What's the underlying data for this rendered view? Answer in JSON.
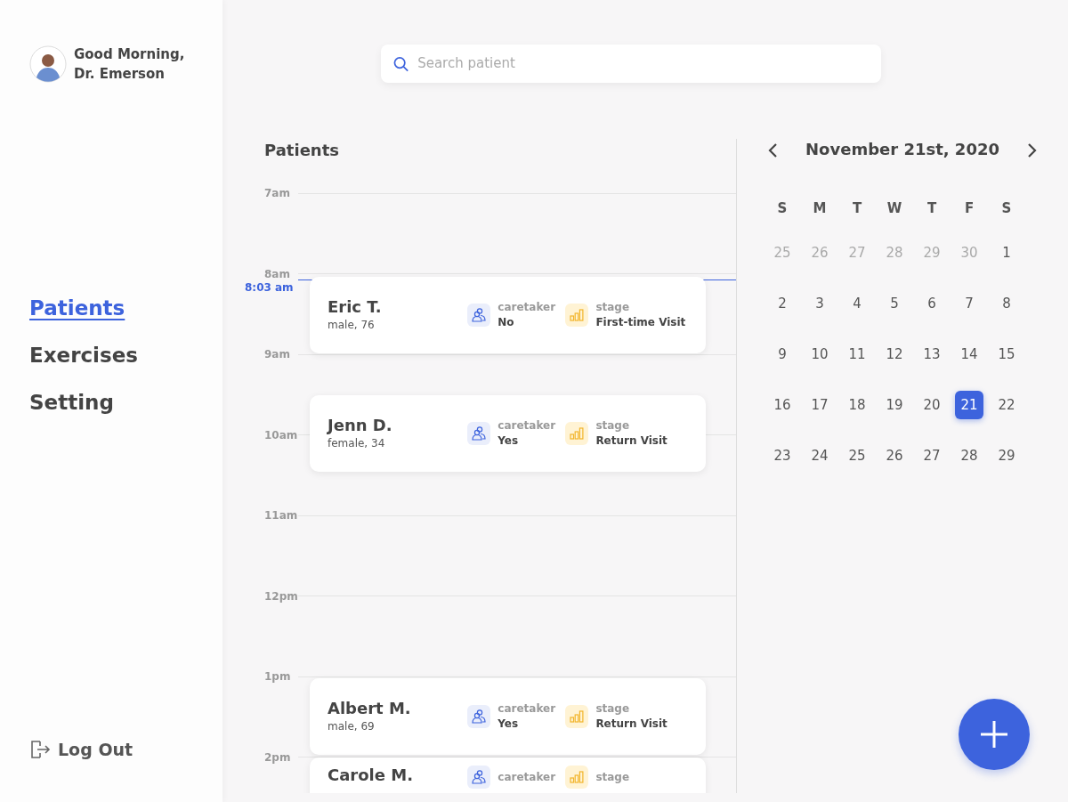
{
  "greeting": {
    "line1": "Good Morning,",
    "line2": "Dr. Emerson"
  },
  "nav": [
    {
      "label": "Patients",
      "selected": true
    },
    {
      "label": "Exercises",
      "selected": false
    },
    {
      "label": "Setting",
      "selected": false
    }
  ],
  "logout": "Log Out",
  "search": {
    "placeholder": "Search patient"
  },
  "schedule": {
    "title": "Patients",
    "hours": [
      "7am",
      "8am",
      "9am",
      "10am",
      "11am",
      "12pm",
      "1pm",
      "2pm"
    ],
    "now": "8:03 am",
    "appointments": [
      {
        "name": "Eric T.",
        "details": "male, 76",
        "caretaker_label": "caretaker",
        "caretaker": "No",
        "stage_label": "stage",
        "stage": "First-time Visit"
      },
      {
        "name": "Jenn D.",
        "details": "female, 34",
        "caretaker_label": "caretaker",
        "caretaker": "Yes",
        "stage_label": "stage",
        "stage": "Return Visit"
      },
      {
        "name": "Albert M.",
        "details": "male, 69",
        "caretaker_label": "caretaker",
        "caretaker": "Yes",
        "stage_label": "stage",
        "stage": "Return Visit"
      },
      {
        "name": "Carole M.",
        "caretaker_label": "caretaker",
        "stage_label": "stage"
      }
    ]
  },
  "calendar": {
    "title": "November 21st, 2020",
    "weekdays": [
      "S",
      "M",
      "T",
      "W",
      "T",
      "F",
      "S"
    ],
    "weeks": [
      [
        {
          "day": "25",
          "muted": true,
          "selected": false
        },
        {
          "day": "26",
          "muted": true,
          "selected": false
        },
        {
          "day": "27",
          "muted": true,
          "selected": false
        },
        {
          "day": "28",
          "muted": true,
          "selected": false
        },
        {
          "day": "29",
          "muted": true,
          "selected": false
        },
        {
          "day": "30",
          "muted": true,
          "selected": false
        },
        {
          "day": "1",
          "muted": false,
          "selected": false
        }
      ],
      [
        {
          "day": "2",
          "muted": false,
          "selected": false
        },
        {
          "day": "3",
          "muted": false,
          "selected": false
        },
        {
          "day": "4",
          "muted": false,
          "selected": false
        },
        {
          "day": "5",
          "muted": false,
          "selected": false
        },
        {
          "day": "6",
          "muted": false,
          "selected": false
        },
        {
          "day": "7",
          "muted": false,
          "selected": false
        },
        {
          "day": "8",
          "muted": false,
          "selected": false
        }
      ],
      [
        {
          "day": "9",
          "muted": false,
          "selected": false
        },
        {
          "day": "10",
          "muted": false,
          "selected": false
        },
        {
          "day": "11",
          "muted": false,
          "selected": false
        },
        {
          "day": "12",
          "muted": false,
          "selected": false
        },
        {
          "day": "13",
          "muted": false,
          "selected": false
        },
        {
          "day": "14",
          "muted": false,
          "selected": false
        },
        {
          "day": "15",
          "muted": false,
          "selected": false
        }
      ],
      [
        {
          "day": "16",
          "muted": false,
          "selected": false
        },
        {
          "day": "17",
          "muted": false,
          "selected": false
        },
        {
          "day": "18",
          "muted": false,
          "selected": false
        },
        {
          "day": "19",
          "muted": false,
          "selected": false
        },
        {
          "day": "20",
          "muted": false,
          "selected": false
        },
        {
          "day": "21",
          "muted": false,
          "selected": true
        },
        {
          "day": "22",
          "muted": false,
          "selected": false
        }
      ],
      [
        {
          "day": "23",
          "muted": false,
          "selected": false
        },
        {
          "day": "24",
          "muted": false,
          "selected": false
        },
        {
          "day": "25",
          "muted": false,
          "selected": false
        },
        {
          "day": "26",
          "muted": false,
          "selected": false
        },
        {
          "day": "27",
          "muted": false,
          "selected": false
        },
        {
          "day": "28",
          "muted": false,
          "selected": false
        },
        {
          "day": "29",
          "muted": false,
          "selected": false
        }
      ]
    ]
  }
}
